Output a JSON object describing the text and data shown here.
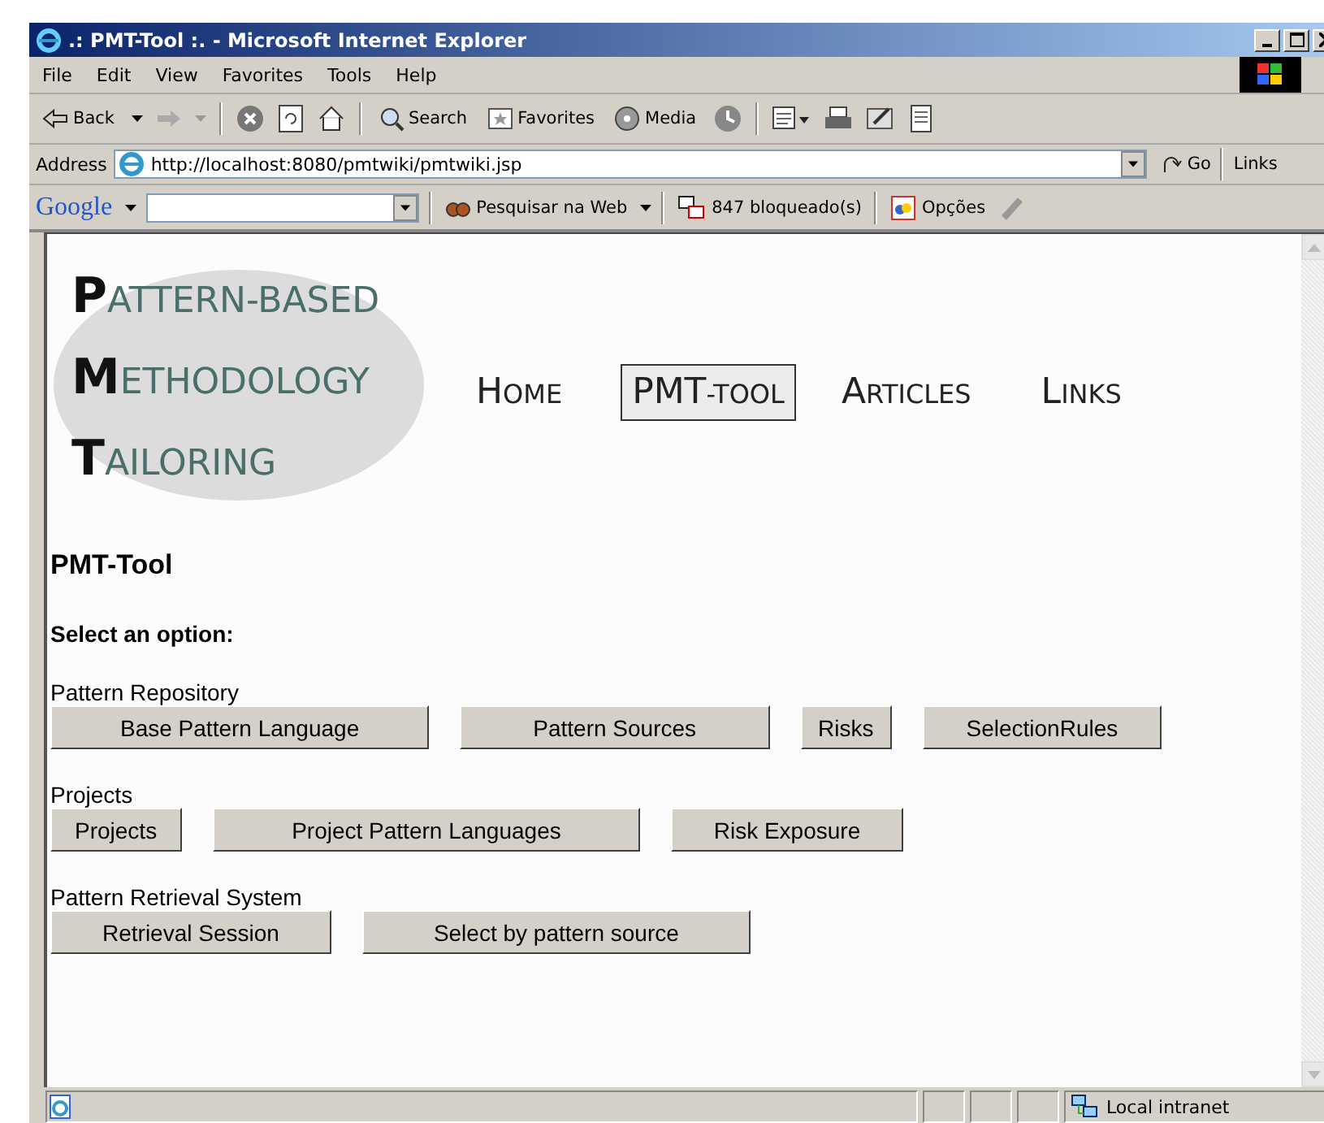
{
  "window": {
    "title": ".: PMT-Tool :. - Microsoft Internet Explorer"
  },
  "menu": [
    "File",
    "Edit",
    "View",
    "Favorites",
    "Tools",
    "Help"
  ],
  "toolbar": [
    {
      "kind": "back",
      "label": "Back"
    },
    {
      "kind": "forward"
    },
    {
      "kind": "stop"
    },
    {
      "kind": "refresh"
    },
    {
      "kind": "home"
    },
    {
      "kind": "search",
      "label": "Search"
    },
    {
      "kind": "favorites",
      "label": "Favorites"
    },
    {
      "kind": "media",
      "label": "Media"
    },
    {
      "kind": "history"
    },
    {
      "kind": "mail"
    },
    {
      "kind": "print"
    },
    {
      "kind": "edit"
    },
    {
      "kind": "discuss"
    }
  ],
  "address": {
    "label": "Address",
    "value": "http://localhost:8080/pmtwiki/pmtwiki.jsp",
    "go": "Go",
    "links": "Links"
  },
  "google_bar": {
    "logo": "Google",
    "search_web": "Pesquisar na Web",
    "blocked": "847 bloqueado(s)",
    "options": "Opções"
  },
  "logo": [
    {
      "initial": "P",
      "rest": "ATTERN-BASED"
    },
    {
      "initial": "M",
      "rest": "ETHODOLOGY"
    },
    {
      "initial": "T",
      "rest": "AILORING"
    }
  ],
  "nav": [
    {
      "big": "H",
      "small": "OME",
      "selected": false
    },
    {
      "big": "PMT",
      "small": "-TOOL",
      "selected": true
    },
    {
      "big": "A",
      "small": "RTICLES",
      "selected": false
    },
    {
      "big": "L",
      "small": "INKS",
      "selected": false
    }
  ],
  "heading": "PMT-Tool",
  "prompt": "Select an option:",
  "sections": [
    {
      "title": "Pattern Repository",
      "buttons": [
        "Base Pattern Language",
        "Pattern Sources",
        "Risks",
        "SelectionRules"
      ]
    },
    {
      "title": "Projects",
      "buttons": [
        "Projects",
        "Project Pattern Languages",
        "Risk Exposure"
      ]
    },
    {
      "title": "Pattern Retrieval System",
      "buttons": [
        "Retrieval Session",
        "Select by pattern source"
      ]
    }
  ],
  "status_bar": {
    "zone": "Local intranet"
  }
}
